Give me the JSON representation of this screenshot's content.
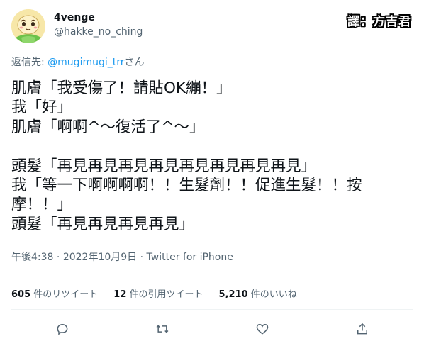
{
  "author": {
    "display_name": "4venge",
    "handle": "@hakke_no_ching"
  },
  "watermark": "譯：方吉君",
  "reply": {
    "prefix": "返信先: ",
    "mention": "@mugimugi_trr",
    "suffix": "さん"
  },
  "tweet": {
    "lines": [
      "肌膚「我受傷了！請貼OK繃！」",
      "我「好」",
      "肌膚「啊啊^～復活了^～」",
      "",
      "頭髮「再見再見再見再見再見再見再見再見」",
      "我「等一下啊啊啊啊！！生髮劑！！促進生髮！！按",
      "摩！！」",
      "頭髮「再見再見再見再見」"
    ]
  },
  "meta": {
    "time": "午後4:38",
    "separator": " · ",
    "date": "2022年10月9日",
    "source": "Twitter for iPhone"
  },
  "stats": {
    "retweets_count": "605",
    "retweets_label": " 件のリツイート",
    "quotes_count": "12",
    "quotes_label": " 件の引用ツイート",
    "likes_count": "5,210",
    "likes_label": " 件のいいね"
  },
  "icons": {
    "reply": "reply-icon",
    "retweet": "retweet-icon",
    "like": "heart-icon",
    "share": "share-icon"
  }
}
